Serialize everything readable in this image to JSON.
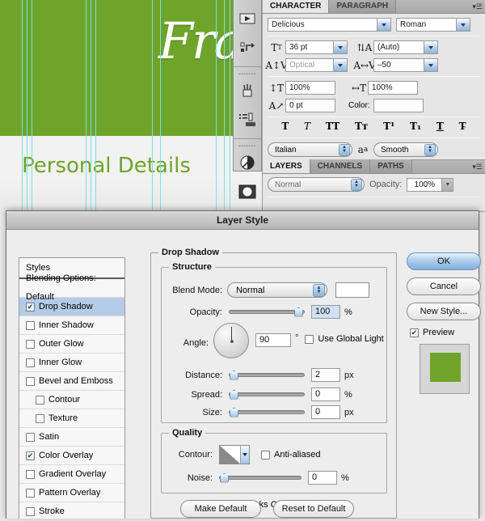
{
  "canvas": {
    "title": "Fra",
    "subtitle": "Personal Details",
    "band_color": "#6ea42a",
    "guide_color": "#7ae0e8",
    "guides": [
      27,
      33,
      39,
      106,
      112,
      118,
      188,
      198,
      267,
      277,
      284
    ]
  },
  "toolstrip": {
    "items": [
      {
        "name": "play-tool-icon",
        "glyph": "▶"
      },
      {
        "name": "history-tool-icon",
        "glyph": "↺"
      },
      {
        "name": "brush-tool-icon",
        "glyph": "⚘"
      },
      {
        "name": "clone-stamp-tool-icon",
        "glyph": "⚙"
      },
      {
        "name": "dodge-burn-tool-icon",
        "glyph": "◑"
      },
      {
        "name": "quick-mask-tool-icon",
        "glyph": "◉"
      }
    ]
  },
  "character_panel": {
    "tabs": [
      {
        "label": "CHARACTER",
        "active": true
      },
      {
        "label": "PARAGRAPH",
        "active": false
      }
    ],
    "menu_icon": "panel-menu-icon",
    "font_family": "Delicious",
    "font_style": "Roman",
    "font_size": "36 pt",
    "leading": "(Auto)",
    "kerning": "Optical",
    "tracking": "–50",
    "vertical_scale": "100%",
    "horizontal_scale": "100%",
    "baseline_shift": "0 pt",
    "color_label": "Color:",
    "color_value": "#ffffff",
    "style_buttons": [
      "T",
      "T",
      "TT",
      "Tт",
      "T¹",
      "T₁",
      "T",
      "T̵"
    ],
    "language": "Italian",
    "aa_icon_label": "a",
    "antialias": "Smooth"
  },
  "layers_panel": {
    "tabs": [
      {
        "label": "LAYERS",
        "active": true
      },
      {
        "label": "CHANNELS",
        "active": false
      },
      {
        "label": "PATHS",
        "active": false
      }
    ],
    "blend_mode": "Normal",
    "opacity_label": "Opacity:",
    "opacity_value": "100%"
  },
  "dialog": {
    "title": "Layer Style",
    "styles": {
      "header": "Styles",
      "items": [
        {
          "label": "Blending Options: Default",
          "checkbox": false,
          "checked": false,
          "selected": false,
          "sub": false
        },
        {
          "label": "Drop Shadow",
          "checkbox": true,
          "checked": true,
          "selected": true,
          "sub": false
        },
        {
          "label": "Inner Shadow",
          "checkbox": true,
          "checked": false,
          "selected": false,
          "sub": false
        },
        {
          "label": "Outer Glow",
          "checkbox": true,
          "checked": false,
          "selected": false,
          "sub": false
        },
        {
          "label": "Inner Glow",
          "checkbox": true,
          "checked": false,
          "selected": false,
          "sub": false
        },
        {
          "label": "Bevel and Emboss",
          "checkbox": true,
          "checked": false,
          "selected": false,
          "sub": false
        },
        {
          "label": "Contour",
          "checkbox": true,
          "checked": false,
          "selected": false,
          "sub": true
        },
        {
          "label": "Texture",
          "checkbox": true,
          "checked": false,
          "selected": false,
          "sub": true
        },
        {
          "label": "Satin",
          "checkbox": true,
          "checked": false,
          "selected": false,
          "sub": false
        },
        {
          "label": "Color Overlay",
          "checkbox": true,
          "checked": true,
          "selected": false,
          "sub": false
        },
        {
          "label": "Gradient Overlay",
          "checkbox": true,
          "checked": false,
          "selected": false,
          "sub": false
        },
        {
          "label": "Pattern Overlay",
          "checkbox": true,
          "checked": false,
          "selected": false,
          "sub": false
        },
        {
          "label": "Stroke",
          "checkbox": true,
          "checked": false,
          "selected": false,
          "sub": false
        }
      ]
    },
    "section_drop_shadow": "Drop Shadow",
    "section_structure": "Structure",
    "section_quality": "Quality",
    "fields": {
      "blend_mode_label": "Blend Mode:",
      "blend_mode_value": "Normal",
      "blend_color": "#ffffff",
      "opacity_label": "Opacity:",
      "opacity_value": "100",
      "opacity_unit": "%",
      "angle_label": "Angle:",
      "angle_value": "90",
      "angle_unit": "°",
      "use_global_light": "Use Global Light",
      "use_global_light_checked": false,
      "distance_label": "Distance:",
      "distance_value": "2",
      "distance_unit": "px",
      "spread_label": "Spread:",
      "spread_value": "0",
      "spread_unit": "%",
      "size_label": "Size:",
      "size_value": "0",
      "size_unit": "px",
      "contour_label": "Contour:",
      "anti_aliased": "Anti-aliased",
      "anti_aliased_checked": false,
      "noise_label": "Noise:",
      "noise_value": "0",
      "noise_unit": "%",
      "knocks_out": "Layer Knocks Out Drop Shadow",
      "knocks_out_checked": true
    },
    "buttons": {
      "ok": "OK",
      "cancel": "Cancel",
      "new_style": "New Style...",
      "preview": "Preview",
      "preview_checked": true,
      "make_default": "Make Default",
      "reset_default": "Reset to Default"
    },
    "preview_swatch_color": "#6ea42a",
    "preview_bg_color": "#d6d6d6"
  }
}
